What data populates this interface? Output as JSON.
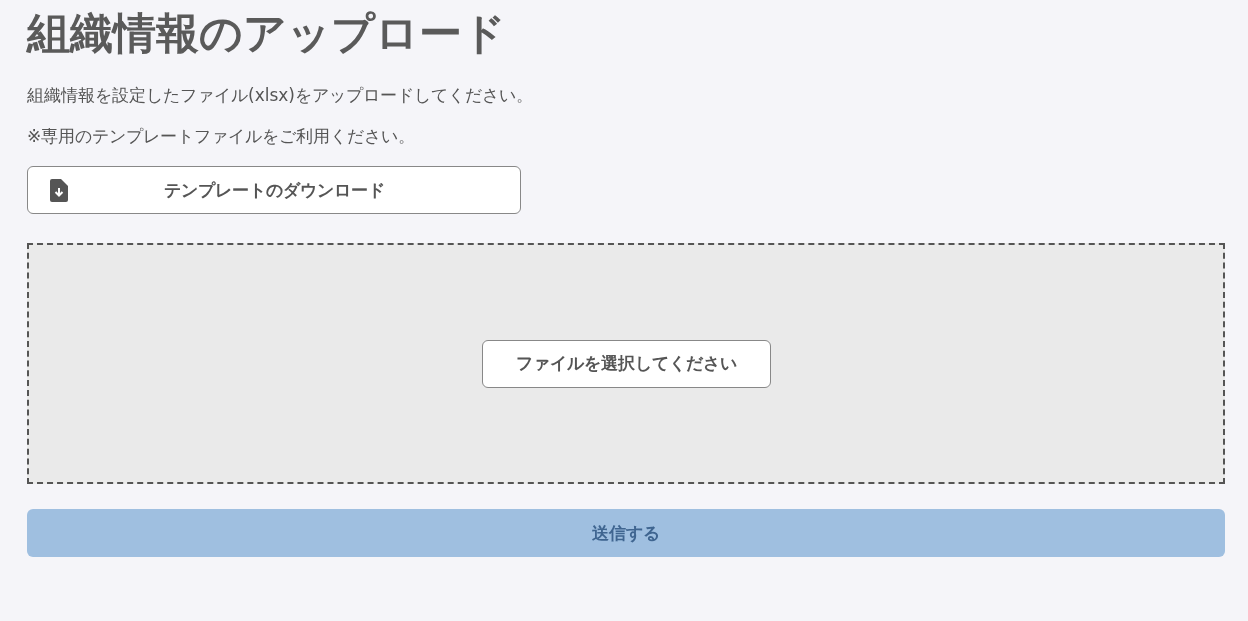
{
  "title": "組織情報のアップロード",
  "instructions": [
    "組織情報を設定したファイル(xlsx)をアップロードしてください。",
    "※専用のテンプレートファイルをご利用ください。"
  ],
  "template_button": {
    "label": "テンプレートのダウンロード"
  },
  "dropzone": {
    "button": "ファイルを選択してください"
  },
  "submit": {
    "label": "送信する",
    "disabled": true
  }
}
